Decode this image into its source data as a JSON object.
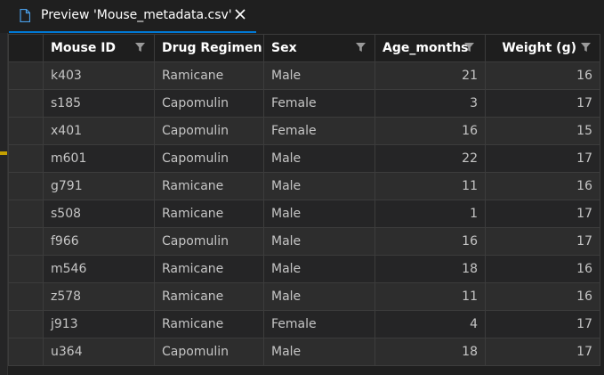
{
  "tab": {
    "title": "Preview 'Mouse_metadata.csv'",
    "icon": "file-icon",
    "close_icon": "close-icon",
    "accent": "#0078d4"
  },
  "table": {
    "columns": [
      "Mouse ID",
      "Drug Regimen",
      "Sex",
      "Age_months",
      "Weight (g)"
    ],
    "rows": [
      [
        "k403",
        "Ramicane",
        "Male",
        "21",
        "16"
      ],
      [
        "s185",
        "Capomulin",
        "Female",
        "3",
        "17"
      ],
      [
        "x401",
        "Capomulin",
        "Female",
        "16",
        "15"
      ],
      [
        "m601",
        "Capomulin",
        "Male",
        "22",
        "17"
      ],
      [
        "g791",
        "Ramicane",
        "Male",
        "11",
        "16"
      ],
      [
        "s508",
        "Ramicane",
        "Male",
        "1",
        "17"
      ],
      [
        "f966",
        "Capomulin",
        "Male",
        "16",
        "17"
      ],
      [
        "m546",
        "Ramicane",
        "Male",
        "18",
        "16"
      ],
      [
        "z578",
        "Ramicane",
        "Male",
        "11",
        "16"
      ],
      [
        "j913",
        "Ramicane",
        "Female",
        "4",
        "17"
      ],
      [
        "u364",
        "Capomulin",
        "Male",
        "18",
        "17"
      ]
    ]
  }
}
